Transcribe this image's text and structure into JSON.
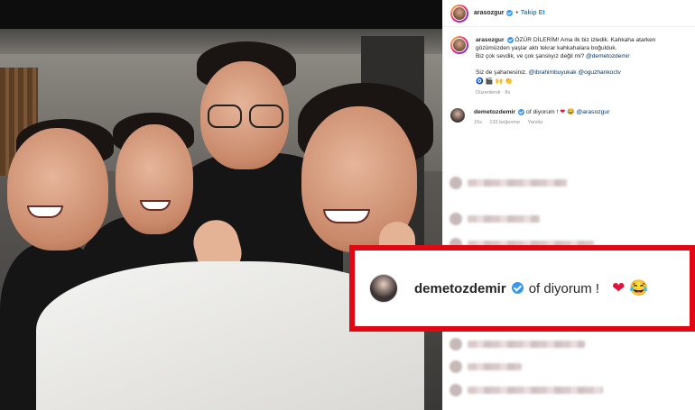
{
  "post": {
    "username": "arasozgur",
    "follow_label": "Takip Et",
    "separator": "•",
    "caption_line1": "ÖZÜR DİLERİM! Ama ilk biz izledik. Kahkaha atarken gözümüzden yaşlar aktı tekrar kahkahalara boğulduk.",
    "caption_line2": "Biz çok sevdik, ve çok şanslıyız değil mi?",
    "caption_mention1": "@demetozdemir",
    "caption_line3": "Siz de şahanesiniz.",
    "caption_mention2": "@ibrahimbuyukak",
    "caption_mention3": "@oguzhankoctv",
    "caption_emojis": [
      "🧿",
      "🎬",
      "🙌",
      "👏"
    ],
    "edited_meta": "Düzenlendi · 8s"
  },
  "comment": {
    "username": "demetozdemir",
    "text": "of diyorum !",
    "heart": "❤",
    "laugh": "😂",
    "mention": "@arasozgur",
    "age": "15s",
    "likes": "133 beğenme",
    "reply": "Yanıtla"
  },
  "highlight": {
    "username": "demetozdemir",
    "text": "of diyorum !",
    "heart": "❤",
    "laugh": "😂",
    "border_color": "#e30613"
  },
  "icons": [
    "verified-badge-icon",
    "heart-emoji-icon",
    "laugh-emoji-icon"
  ],
  "colors": {
    "link": "#0095f6",
    "mention": "#00376b",
    "verified": "#3897f0"
  }
}
